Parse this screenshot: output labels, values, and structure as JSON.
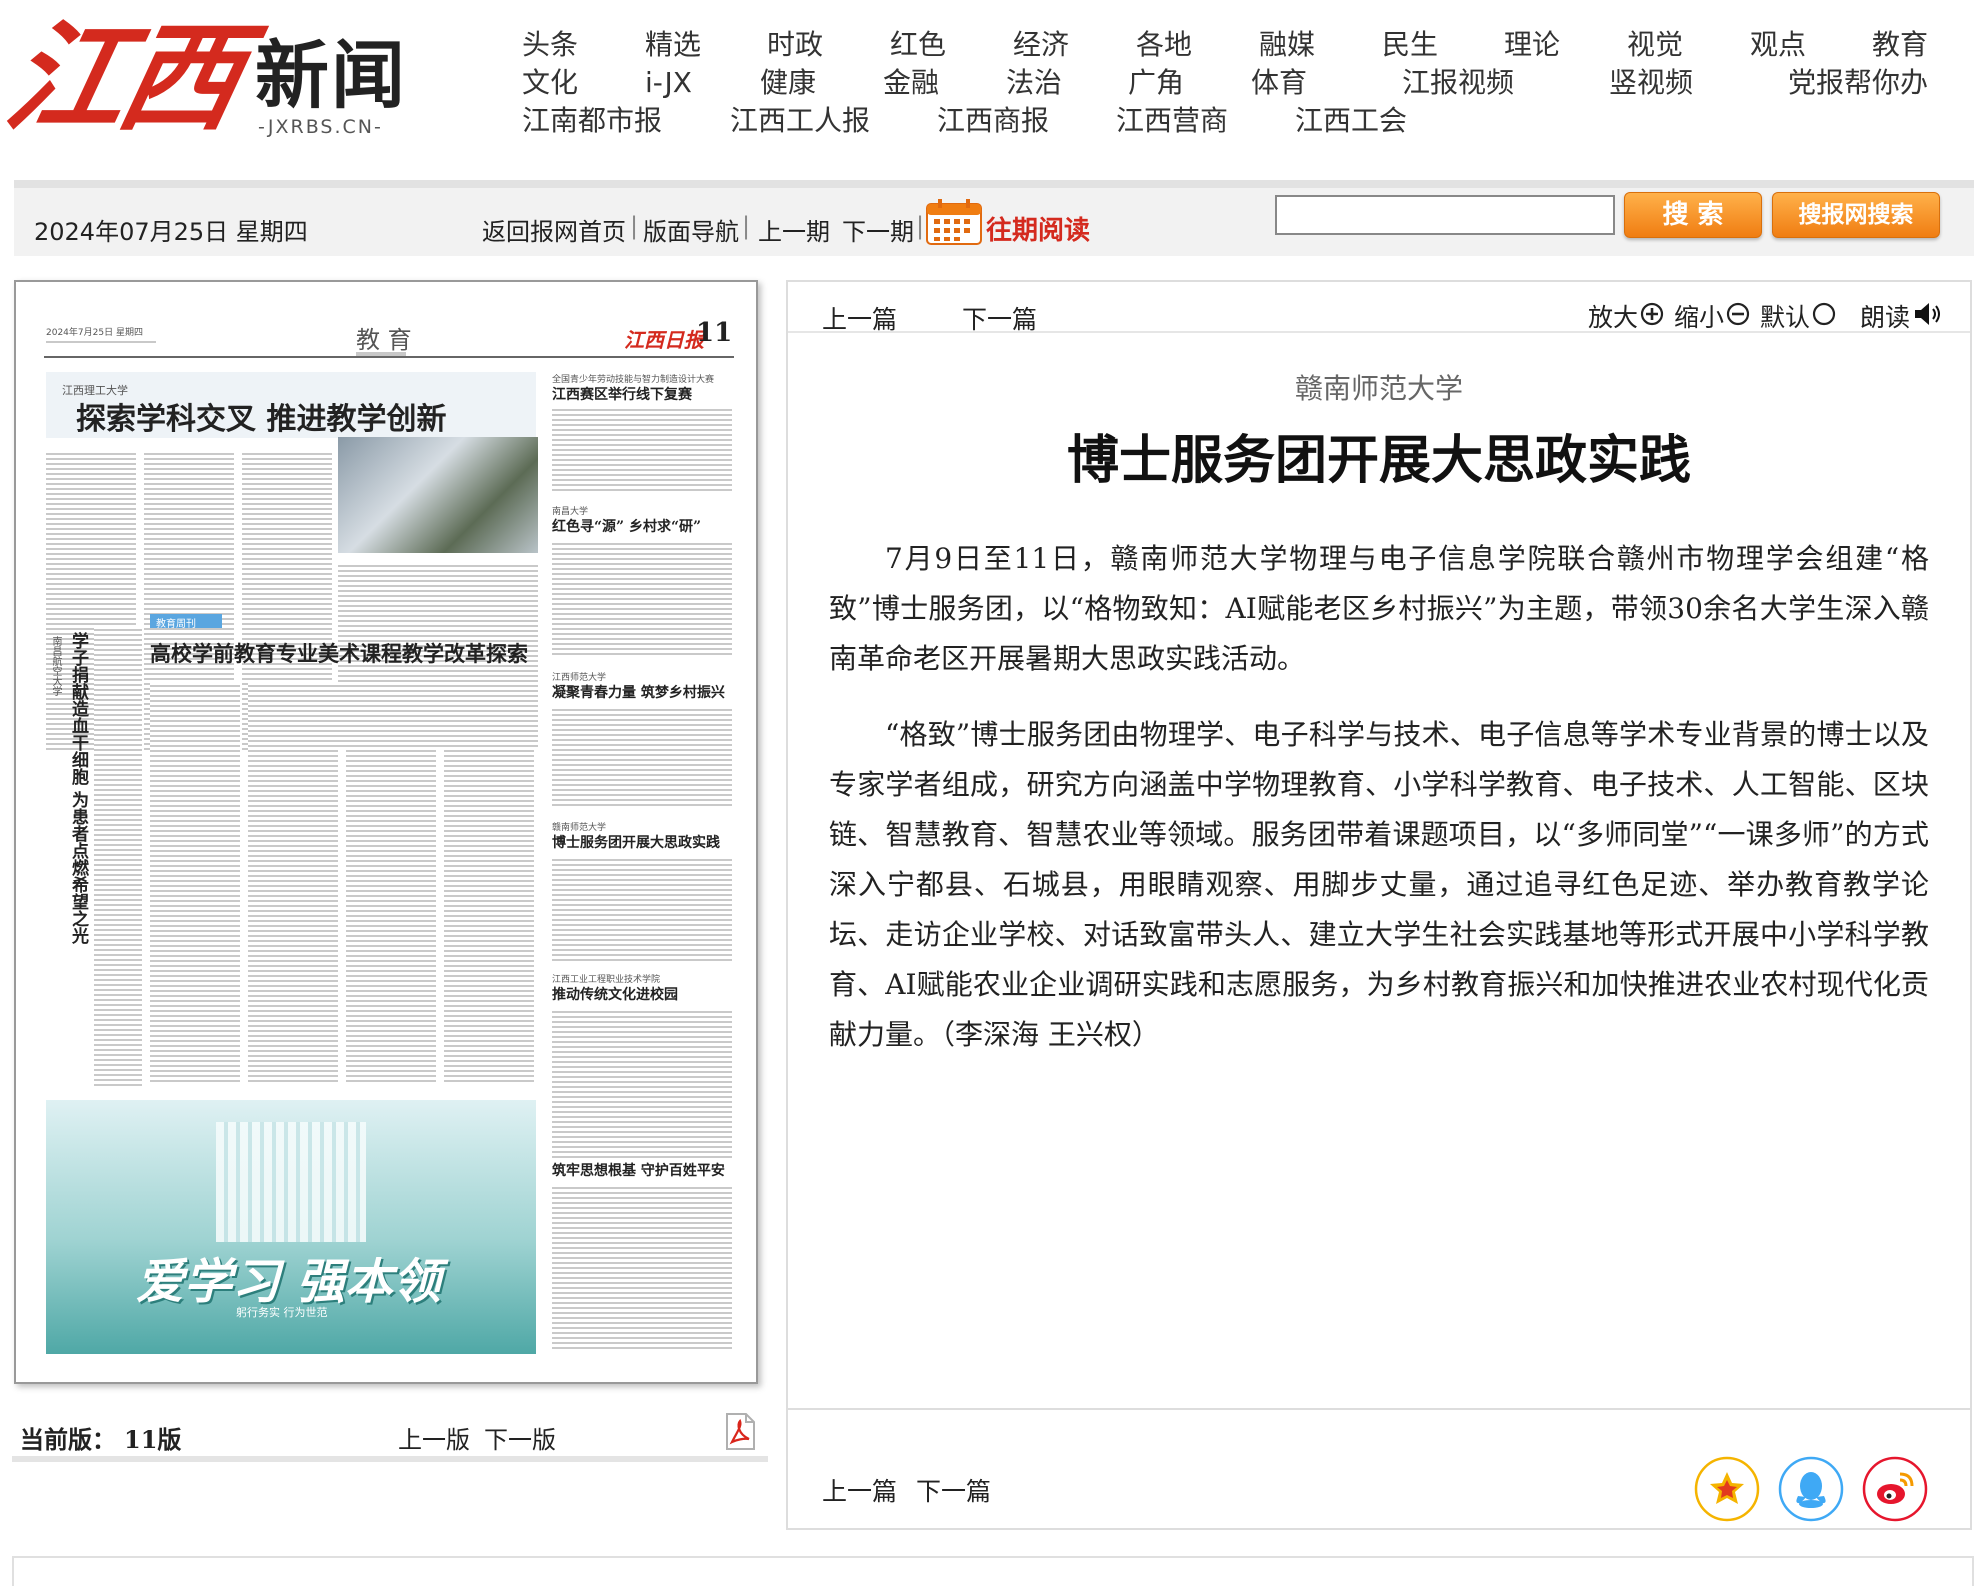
{
  "site": {
    "logo_script": "江西",
    "logo_text": "新闻",
    "logo_domain": "-JXRBS.CN-",
    "nav_row1": [
      "头条",
      "精选",
      "时政",
      "红色",
      "经济",
      "各地",
      "融媒",
      "民生",
      "理论",
      "视觉",
      "观点",
      "教育"
    ],
    "nav_row2": [
      "文化",
      "i-JX",
      "健康",
      "金融",
      "法治",
      "广角",
      "体育",
      "江报视频",
      "竖视频",
      "党报帮你办"
    ],
    "nav_row3": [
      "江南都市报",
      "江西工人报",
      "江西商报",
      "江西营商",
      "江西工会"
    ]
  },
  "toolbar": {
    "date": "2024年07月25日 星期四",
    "links": [
      "返回报网首页",
      "版面导航",
      "上一期",
      "下一期"
    ],
    "separator": "|",
    "archive": "往期阅读",
    "search_value": "",
    "search_button": "搜 索",
    "site_search_button": "搜报网搜索"
  },
  "newspaper_page": {
    "date_line": "2024年7月25日 星期四",
    "section": "教 育",
    "masthead": "江西日报",
    "page_no": "11",
    "headline_main": "探索学科交叉   推进教学创新",
    "kicker_main": "江西理工大学",
    "headline_2": "高校学前教育专业美术课程教学改革探索",
    "vertical_headline": "学子捐献造血干细胞   为患者点燃希望之光",
    "vertical_kicker": "南昌航空大学",
    "right_items": [
      {
        "kicker": "全国青少年劳动技能与智力制造设计大赛",
        "title": "江西赛区举行线下复赛"
      },
      {
        "kicker": "南昌大学",
        "title": "红色寻“源”  乡村求“研”"
      },
      {
        "kicker": "江西师范大学",
        "title": "凝聚青春力量  筑梦乡村振兴"
      },
      {
        "kicker": "赣南师范大学",
        "title": "博士服务团开展大思政实践"
      },
      {
        "kicker": "江西工业工程职业技术学院",
        "title": "推动传统文化进校园"
      },
      {
        "kicker": "",
        "title": "筑牢思想根基  守护百姓平安"
      }
    ],
    "banner_text": "爱学习 强本领",
    "banner_sub": "躬行务实   行为世范",
    "badge": "教育周刊"
  },
  "page_footer": {
    "current_label": "当前版：",
    "current_value": "11版",
    "prev": "上一版",
    "next": "下一版"
  },
  "article": {
    "top_prev": "上一篇",
    "top_next": "下一篇",
    "zoom_in": "放大",
    "zoom_out": "缩小",
    "default": "默认",
    "read": "朗读",
    "subtitle": "赣南师范大学",
    "title": "博士服务团开展大思政实践",
    "paragraphs": [
      "7月9日至11日，赣南师范大学物理与电子信息学院联合赣州市物理学会组建“格致”博士服务团，以“格物致知：AI赋能老区乡村振兴”为主题，带领30余名大学生深入赣南革命老区开展暑期大思政实践活动。",
      "“格致”博士服务团由物理学、电子科学与技术、电子信息等学术专业背景的博士以及专家学者组成，研究方向涵盖中学物理教育、小学科学教育、电子技术、人工智能、区块链、智慧教育、智慧农业等领域。服务团带着课题项目，以“多师同堂”“一课多师”的方式深入宁都县、石城县，用眼睛观察、用脚步丈量，通过追寻红色足迹、举办教育教学论坛、走访企业学校、对话致富带头人、建立大学生社会实践基地等形式开展中小学科学教育、AI赋能农业企业调研实践和志愿服务，为乡村教育振兴和加快推进农业农村现代化贡献力量。（李深海  王兴权）"
    ],
    "bottom_prev": "上一篇",
    "bottom_next": "下一篇"
  },
  "colors": {
    "brand_red": "#d42a1e",
    "button_orange": "#f07d12",
    "share_gold": "#f5b400",
    "share_qq": "#3fa9f5",
    "share_weibo": "#e6162d"
  }
}
